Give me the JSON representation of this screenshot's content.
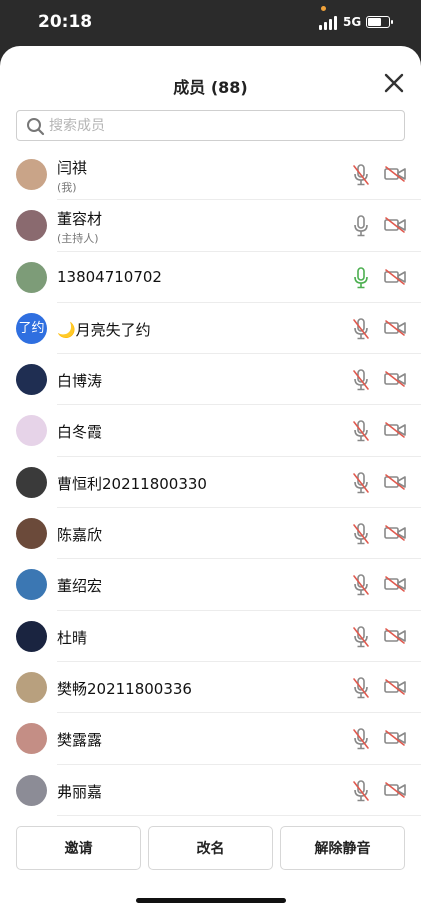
{
  "status_bar": {
    "time": "20:18",
    "network": "5G"
  },
  "header": {
    "title": "成员 (88)"
  },
  "search": {
    "placeholder": "搜索成员"
  },
  "members": [
    {
      "name": "闫祺",
      "role": "(我)",
      "mic": "muted",
      "camera": "off",
      "avatar_color": "#c9a488"
    },
    {
      "name": "董容材",
      "role": "(主持人)",
      "mic": "on",
      "camera": "off",
      "avatar_color": "#8a6a6f"
    },
    {
      "name": "13804710702",
      "role": "",
      "mic": "active",
      "camera": "off",
      "avatar_color": "#7d9c78"
    },
    {
      "name": "🌙月亮失了约",
      "role": "",
      "mic": "muted",
      "camera": "off",
      "avatar_text": "了约",
      "avatar_color": "#2f6fe0"
    },
    {
      "name": "白博涛",
      "role": "",
      "mic": "muted",
      "camera": "off",
      "avatar_color": "#1f2e52"
    },
    {
      "name": "白冬霞",
      "role": "",
      "mic": "muted",
      "camera": "off",
      "avatar_color": "#e6d3e8"
    },
    {
      "name": "曹恒利20211800330",
      "role": "",
      "mic": "muted",
      "camera": "off",
      "avatar_color": "#3a3a3a"
    },
    {
      "name": "陈嘉欣",
      "role": "",
      "mic": "muted",
      "camera": "off",
      "avatar_color": "#6b4a3a"
    },
    {
      "name": "董绍宏",
      "role": "",
      "mic": "muted",
      "camera": "off",
      "avatar_color": "#3b77b3"
    },
    {
      "name": "杜晴",
      "role": "",
      "mic": "muted",
      "camera": "off",
      "avatar_color": "#1a2440"
    },
    {
      "name": "樊畅20211800336",
      "role": "",
      "mic": "muted",
      "camera": "off",
      "avatar_color": "#b8a07e"
    },
    {
      "name": "樊露露",
      "role": "",
      "mic": "muted",
      "camera": "off",
      "avatar_color": "#c48e85"
    },
    {
      "name": "弗丽嘉",
      "role": "",
      "mic": "muted",
      "camera": "off",
      "avatar_color": "#8c8c96"
    }
  ],
  "actions": {
    "invite": "邀请",
    "rename": "改名",
    "unmute": "解除静音"
  },
  "colors": {
    "muted": "#e05a4f",
    "active": "#4caf50",
    "icon_gray": "#888888"
  }
}
